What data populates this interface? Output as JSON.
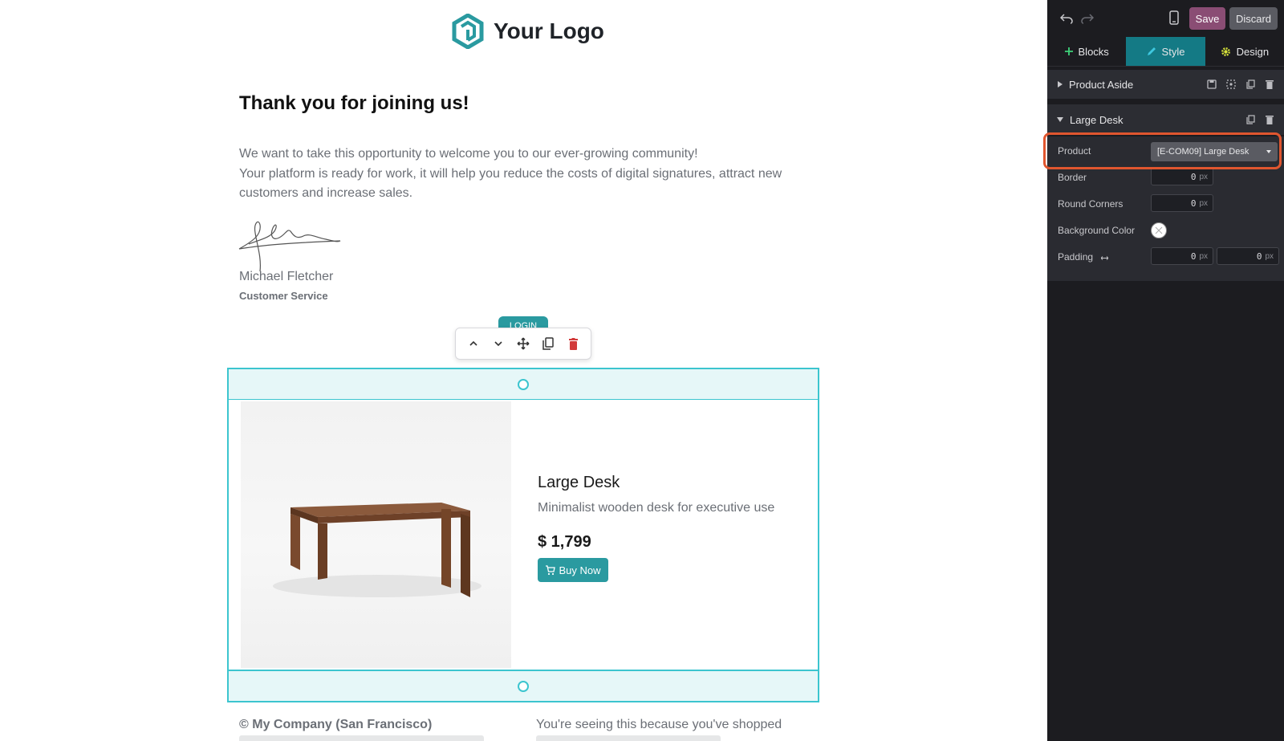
{
  "email": {
    "logo_text": "Your Logo",
    "heading": "Thank you for joining us!",
    "paragraph_1": "We want to take this opportunity to welcome you to our ever-growing community!",
    "paragraph_2": "Your platform is ready for work, it will help you reduce the costs of digital signatures, attract new customers and increase sales.",
    "signer_name": "Michael Fletcher",
    "signer_role": "Customer Service",
    "login_button": "LOGIN",
    "product": {
      "name": "Large Desk",
      "description": "Minimalist wooden desk for executive use",
      "price": "$ 1,799",
      "buy_label": "Buy Now"
    },
    "footer_left": "© My Company (San Francisco)",
    "footer_right": "You're seeing this because you've shopped"
  },
  "editor": {
    "top": {
      "save_label": "Save",
      "discard_label": "Discard"
    },
    "tabs": [
      {
        "label": "Blocks",
        "icon": "plus-icon",
        "active": false
      },
      {
        "label": "Style",
        "icon": "pencil-icon",
        "active": true
      },
      {
        "label": "Design",
        "icon": "gear-icon",
        "active": false
      }
    ],
    "sections": {
      "aside_title": "Product Aside",
      "desk_title": "Large Desk"
    },
    "properties": {
      "product_label": "Product",
      "product_value": "[E-COM09] Large Desk",
      "border_label": "Border",
      "border_value": "0",
      "corners_label": "Round Corners",
      "corners_value": "0",
      "bg_label": "Background Color",
      "padding_label": "Padding",
      "padding_left": "0",
      "padding_right": "0",
      "unit": "px"
    }
  },
  "colors": {
    "accent": "#2a9aa0",
    "selection": "#3cc5cf",
    "save": "#8a4d74",
    "highlight": "#e0562f"
  }
}
